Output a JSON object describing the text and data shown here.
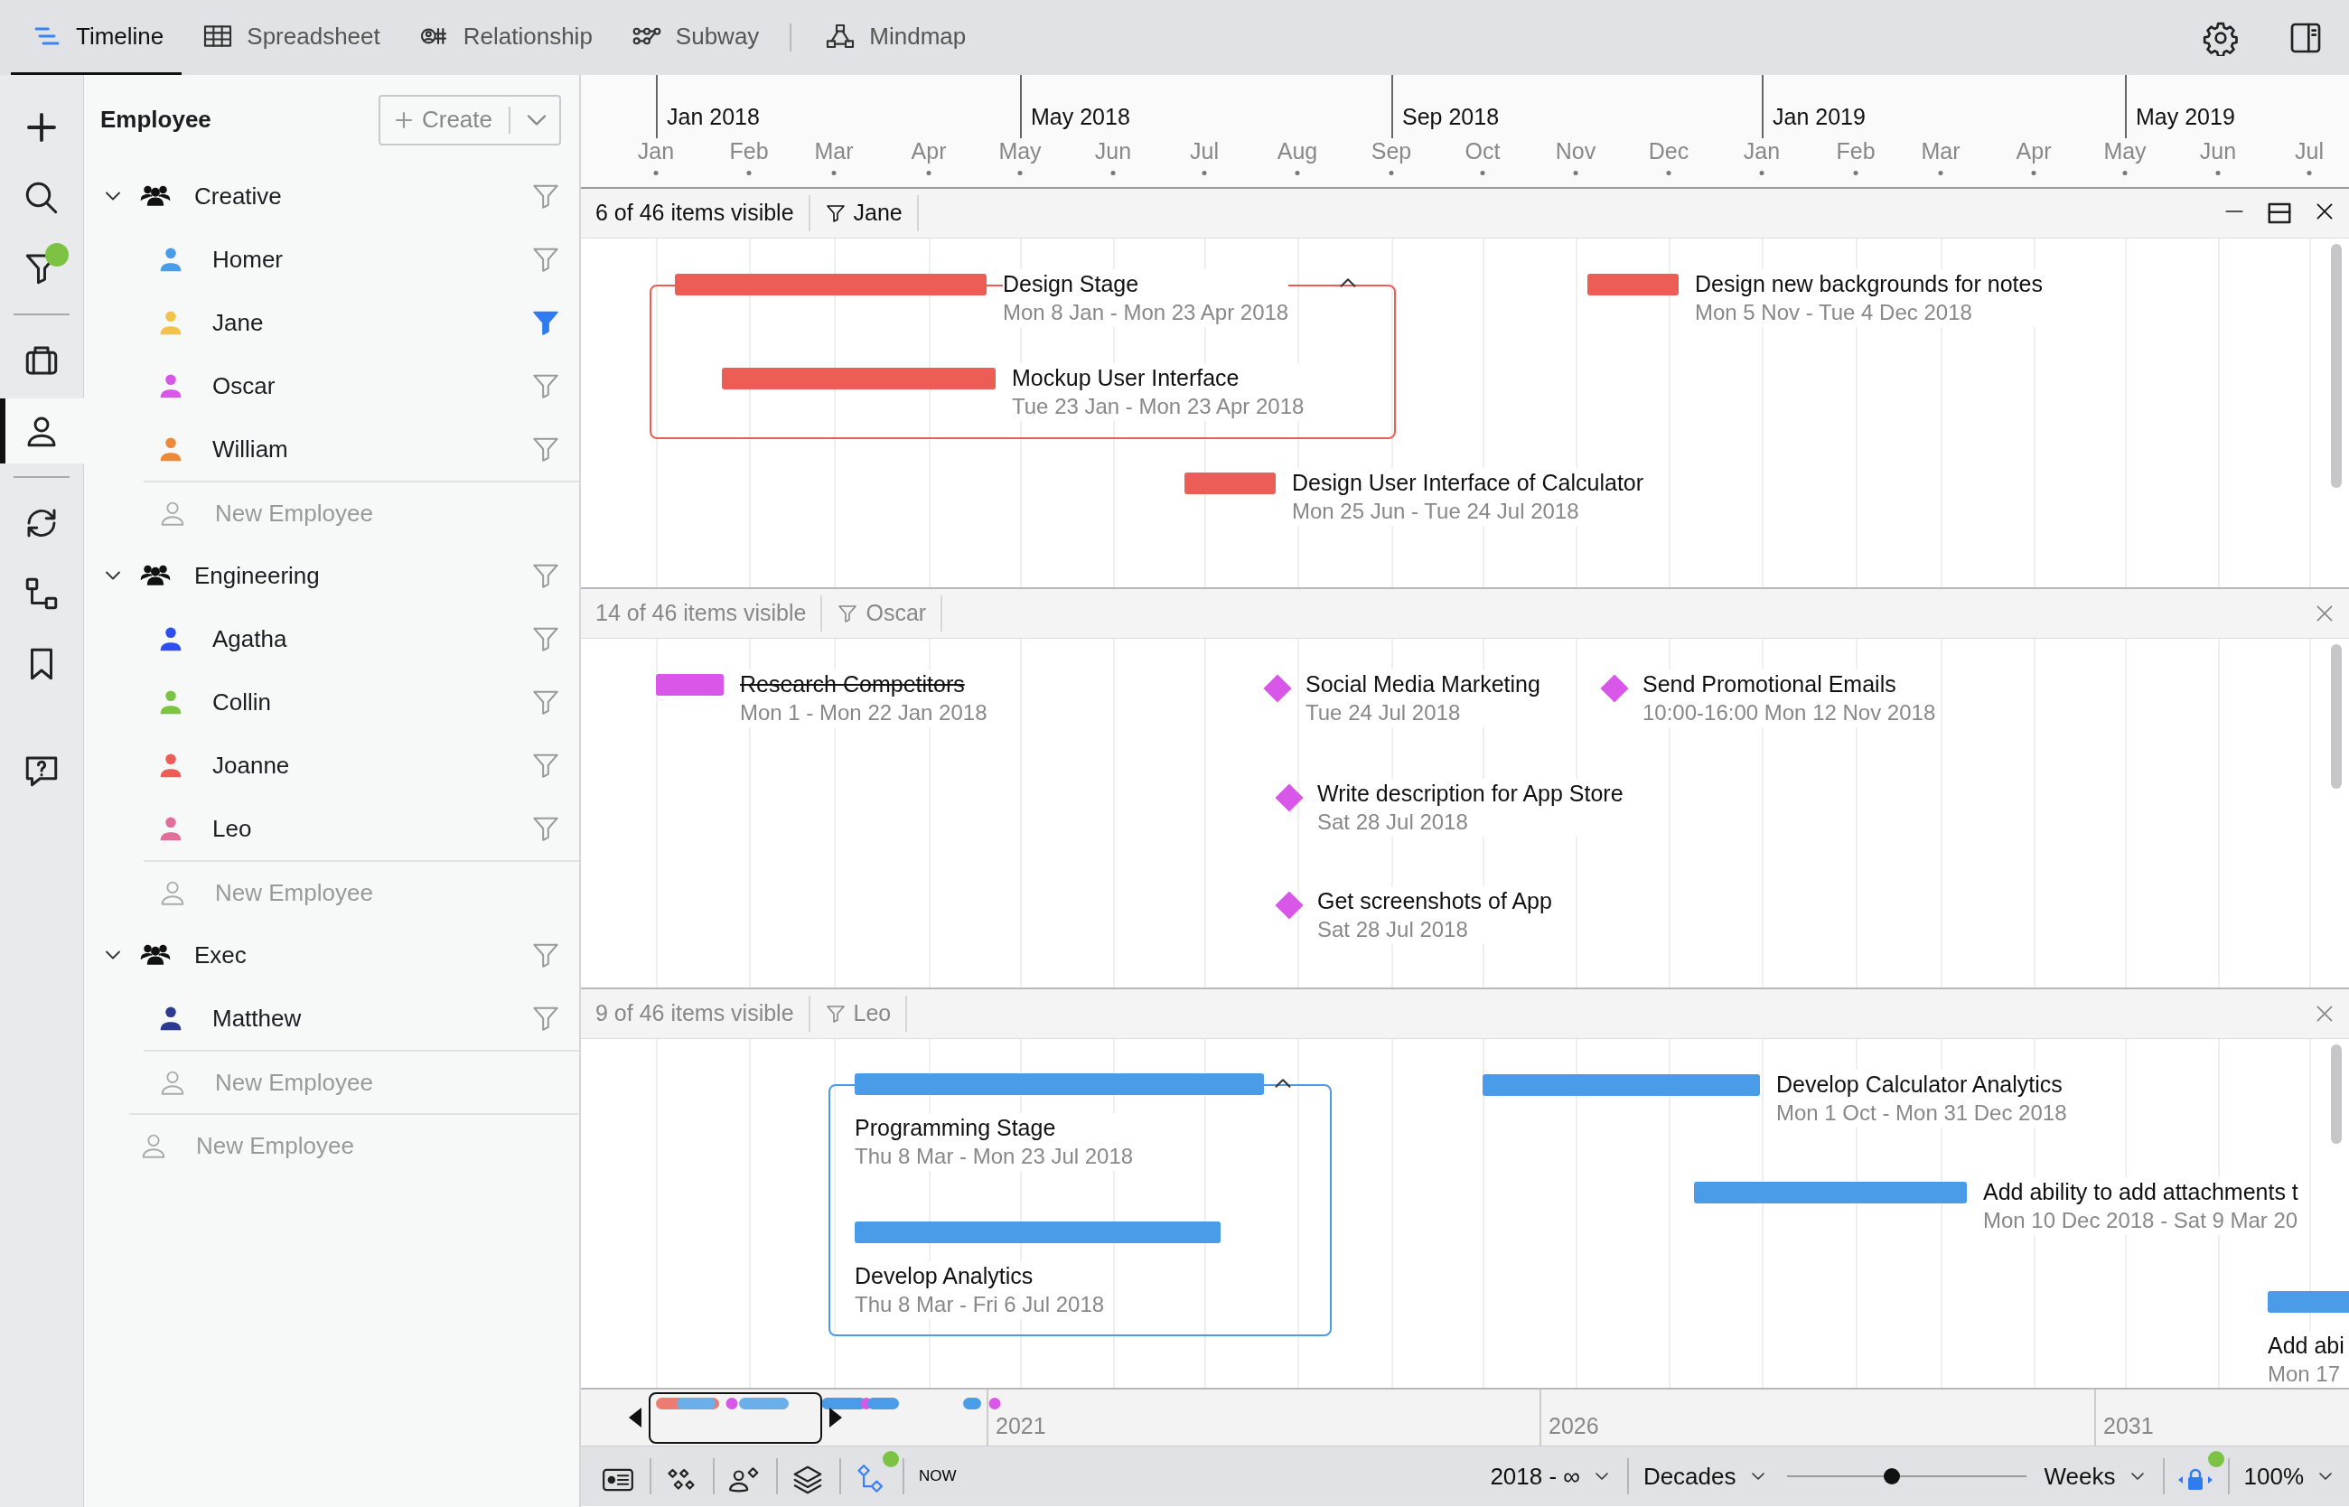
{
  "tabs": [
    {
      "label": "Timeline",
      "selected": true
    },
    {
      "label": "Spreadsheet",
      "selected": false
    },
    {
      "label": "Relationship",
      "selected": false
    },
    {
      "label": "Subway",
      "selected": false
    },
    {
      "label": "Mindmap",
      "selected": false
    }
  ],
  "rail": [
    {
      "selected": false,
      "badge": false
    },
    {
      "selected": false,
      "badge": false
    },
    {
      "selected": false,
      "badge": true
    },
    {
      "selected": false,
      "badge": false
    },
    {
      "selected": true,
      "badge": false
    },
    {
      "selected": false,
      "badge": false
    },
    {
      "selected": false,
      "badge": false
    },
    {
      "selected": false,
      "badge": false
    },
    {
      "selected": false,
      "badge": false
    }
  ],
  "sidebar": {
    "title": "Employee",
    "create_button": "Create",
    "add_label": "New Employee",
    "groups": [
      {
        "name": "Creative",
        "expanded": true,
        "filtered": false,
        "add_label": "New Employee",
        "children": [
          {
            "name": "Homer",
            "color": "#4a9be8",
            "filtered": false
          },
          {
            "name": "Jane",
            "color": "#f2c24b",
            "filtered": true
          },
          {
            "name": "Oscar",
            "color": "#d957e8",
            "filtered": false
          },
          {
            "name": "William",
            "color": "#ea8a3a",
            "filtered": false
          }
        ]
      },
      {
        "name": "Engineering",
        "expanded": true,
        "filtered": false,
        "add_label": "New Employee",
        "children": [
          {
            "name": "Agatha",
            "color": "#2f4ef0",
            "filtered": false
          },
          {
            "name": "Collin",
            "color": "#7cc243",
            "filtered": false
          },
          {
            "name": "Joanne",
            "color": "#ec5d55",
            "filtered": false
          },
          {
            "name": "Leo",
            "color": "#e0709a",
            "filtered": false
          }
        ]
      },
      {
        "name": "Exec",
        "expanded": true,
        "filtered": false,
        "add_label": "New Employee",
        "children": [
          {
            "name": "Matthew",
            "color": "#2c3a8f",
            "filtered": false
          }
        ]
      }
    ]
  },
  "timescale": {
    "years": [
      "Jan 2018",
      "May 2018",
      "Sep 2018",
      "Jan 2019",
      "May 2019"
    ],
    "months": [
      "Jan",
      "Feb",
      "Mar",
      "Apr",
      "May",
      "Jun",
      "Jul",
      "Aug",
      "Sep",
      "Oct",
      "Nov",
      "Dec",
      "Jan",
      "Feb",
      "Mar",
      "Apr",
      "May",
      "Jun",
      "Jul"
    ]
  },
  "lanes": [
    {
      "count": "6 of 46 items visible",
      "filter": "Jane",
      "active": true,
      "items": [
        {
          "kind": "group",
          "expanded": true,
          "color": "#ec5d55",
          "children": [
            {
              "kind": "bar",
              "title": "Design Stage",
              "dates": "Mon 8 Jan - Mon 23 Apr 2018",
              "color": "#ec5d55",
              "completed": false
            },
            {
              "kind": "bar",
              "title": "Mockup User Interface",
              "dates": "Tue 23 Jan - Mon 23 Apr 2018",
              "color": "#ec5d55",
              "completed": false
            }
          ]
        },
        {
          "kind": "bar",
          "title": "Design new backgrounds for notes",
          "dates": "Mon 5 Nov - Tue 4 Dec 2018",
          "color": "#ec5d55",
          "completed": false
        },
        {
          "kind": "bar",
          "title": "Design User Interface of Calculator",
          "dates": "Mon 25 Jun - Tue 24 Jul 2018",
          "color": "#ec5d55",
          "completed": false
        }
      ]
    },
    {
      "count": "14 of 46 items visible",
      "filter": "Oscar",
      "active": false,
      "items": [
        {
          "kind": "bar",
          "title": "Research Competitors",
          "dates": "Mon 1 - Mon 22 Jan 2018",
          "color": "#d957e8",
          "completed": true
        },
        {
          "kind": "milestone",
          "title": "Social Media Marketing",
          "dates": "Tue 24 Jul 2018",
          "color": "#d957e8",
          "completed": false
        },
        {
          "kind": "milestone",
          "title": "Send Promotional Emails",
          "dates": "10:00-16:00 Mon 12 Nov 2018",
          "color": "#d957e8",
          "completed": false
        },
        {
          "kind": "milestone",
          "title": "Write description for App Store",
          "dates": "Sat 28 Jul 2018",
          "color": "#d957e8",
          "completed": false
        },
        {
          "kind": "milestone",
          "title": "Get screenshots of App",
          "dates": "Sat 28 Jul 2018",
          "color": "#d957e8",
          "completed": false
        }
      ]
    },
    {
      "count": "9 of 46 items visible",
      "filter": "Leo",
      "active": false,
      "items": [
        {
          "kind": "group",
          "expanded": true,
          "color": "#4a9be8",
          "children": [
            {
              "kind": "bar_above",
              "title": "Programming Stage",
              "dates": "Thu 8 Mar - Mon 23 Jul 2018",
              "color": "#4a9be8",
              "completed": false
            },
            {
              "kind": "bar_above",
              "title": "Develop Analytics",
              "dates": "Thu 8 Mar - Fri 6 Jul 2018",
              "color": "#4a9be8",
              "completed": false
            }
          ]
        },
        {
          "kind": "bar",
          "title": "Develop Calculator Analytics",
          "dates": "Mon 1 Oct - Mon 31 Dec 2018",
          "color": "#4a9be8",
          "completed": false
        },
        {
          "kind": "bar",
          "title": "Add ability to add attachments t",
          "dates": "Mon 10 Dec 2018 - Sat 9 Mar 20",
          "color": "#4a9be8",
          "completed": false
        },
        {
          "kind": "bar_above",
          "title": "Add abi",
          "dates": "Mon 17",
          "color": "#4a9be8",
          "completed": false
        }
      ]
    }
  ],
  "overview": {
    "years": [
      "2021",
      "2026",
      "2031"
    ]
  },
  "status_bar": {
    "tools": [
      {
        "active": false,
        "badge": false
      },
      {
        "active": false,
        "badge": false
      },
      {
        "active": false,
        "badge": false
      },
      {
        "active": false,
        "badge": false
      },
      {
        "active": true,
        "badge": true
      }
    ],
    "now": "NOW",
    "range": "2018 - ∞",
    "scale_from": "Decades",
    "zoom": {
      "level": 0.44
    },
    "scale_to": "Weeks",
    "lock": {
      "active": true,
      "badge": true
    },
    "percent": "100%"
  }
}
